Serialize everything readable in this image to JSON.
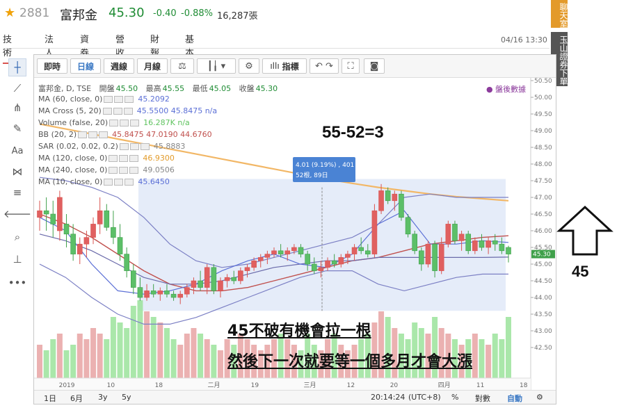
{
  "header": {
    "code": "2881",
    "name": "富邦金",
    "price": "45.30",
    "change": "-0.40",
    "change_pct": "-0.88%",
    "volume": "16,287張",
    "datetime": "04/16 13:30"
  },
  "tabs": [
    "技術",
    "法人",
    "資券",
    "營收",
    "財報",
    "基本"
  ],
  "toolbar": {
    "intraday": "即時",
    "daily": "日線",
    "weekly": "週線",
    "monthly": "月線",
    "indicators": "指標"
  },
  "side_tabs": {
    "chat": "聊天室",
    "download": "玉山證券下單"
  },
  "legend": {
    "title": "富邦金, D, TSE",
    "open_label": "開盤",
    "open": "45.50",
    "high_label": "最高",
    "high": "45.55",
    "low_label": "最低",
    "low": "45.05",
    "close_label": "收盤",
    "close": "45.30",
    "after_hours": "● 盤後數據",
    "rows": [
      {
        "name": "MA (60, close, 0)",
        "values": "45.2092",
        "color": "#5b6fd6"
      },
      {
        "name": "MA Cross (5, 20)",
        "values": "45.5500  45.8475  n/a",
        "color": "#5b6fd6"
      },
      {
        "name": "Volume (false, 20)",
        "values": "16.287K  n/a",
        "color": "#5fc35f"
      },
      {
        "name": "BB (20, 2)",
        "values": "45.8475  47.0190  44.6760",
        "color": "#c0504d"
      },
      {
        "name": "SAR (0.02, 0.02, 0.2)",
        "values": "45.8883",
        "color": "#888888"
      },
      {
        "name": "MA (120, close, 0)",
        "values": "46.9300",
        "color": "#e29b2b"
      },
      {
        "name": "MA (240, close, 0)",
        "values": "49.0506",
        "color": "#888888"
      },
      {
        "name": "MA (10, close, 0)",
        "values": "45.6450",
        "color": "#5b6fd6"
      }
    ]
  },
  "tooltip": {
    "line1": "4.01 (9.19%) , 401",
    "line2": "52根, 89日"
  },
  "bottom_bar": {
    "ranges": [
      "1日",
      "6月",
      "3y",
      "5y"
    ],
    "clock": "20:14:24",
    "tz": "(UTC+8)",
    "pct": "%",
    "log": "對數",
    "auto": "自動"
  },
  "annotations": {
    "equation": "55-52=3",
    "support": "45",
    "line1": "45不破有機會拉一根",
    "line2": "然後下一次就要等一個多月才會大漲"
  },
  "chart_data": {
    "type": "candlestick",
    "price_ylim": [
      42.0,
      50.5
    ],
    "price_ticks": [
      "50.50",
      "50.00",
      "49.50",
      "49.00",
      "48.50",
      "48.00",
      "47.50",
      "47.00",
      "46.50",
      "46.00",
      "45.50",
      "45.00",
      "44.50",
      "44.00",
      "43.50",
      "43.00",
      "42.50"
    ],
    "current_price_label": "45.30",
    "x_ticks": [
      "2019",
      "10",
      "18",
      "二月",
      "19",
      "三月",
      "12",
      "20",
      "四月",
      "11",
      "18"
    ],
    "candles": [
      {
        "o": 46.4,
        "h": 46.9,
        "l": 46.0,
        "c": 46.6
      },
      {
        "o": 46.6,
        "h": 47.0,
        "l": 46.0,
        "c": 46.5
      },
      {
        "o": 46.5,
        "h": 46.9,
        "l": 45.8,
        "c": 46.2
      },
      {
        "o": 46.0,
        "h": 47.2,
        "l": 45.7,
        "c": 47.0
      },
      {
        "o": 46.2,
        "h": 46.5,
        "l": 45.5,
        "c": 45.9
      },
      {
        "o": 45.9,
        "h": 46.2,
        "l": 45.1,
        "c": 45.3
      },
      {
        "o": 45.3,
        "h": 45.8,
        "l": 45.0,
        "c": 45.6
      },
      {
        "o": 45.6,
        "h": 46.0,
        "l": 45.2,
        "c": 45.8
      },
      {
        "o": 45.8,
        "h": 46.4,
        "l": 45.6,
        "c": 46.2
      },
      {
        "o": 46.2,
        "h": 47.0,
        "l": 45.9,
        "c": 46.6
      },
      {
        "o": 46.6,
        "h": 46.8,
        "l": 46.0,
        "c": 46.1
      },
      {
        "o": 46.1,
        "h": 46.6,
        "l": 45.6,
        "c": 45.8
      },
      {
        "o": 45.8,
        "h": 46.2,
        "l": 45.1,
        "c": 45.3
      },
      {
        "o": 45.3,
        "h": 45.5,
        "l": 44.6,
        "c": 44.8
      },
      {
        "o": 44.8,
        "h": 45.0,
        "l": 44.1,
        "c": 44.3
      },
      {
        "o": 44.3,
        "h": 44.6,
        "l": 43.9,
        "c": 44.0
      },
      {
        "o": 44.0,
        "h": 44.4,
        "l": 43.9,
        "c": 44.2
      },
      {
        "o": 44.2,
        "h": 44.4,
        "l": 44.0,
        "c": 44.1
      },
      {
        "o": 44.1,
        "h": 44.3,
        "l": 43.9,
        "c": 44.2
      },
      {
        "o": 44.2,
        "h": 44.4,
        "l": 44.0,
        "c": 44.1
      },
      {
        "o": 44.1,
        "h": 44.2,
        "l": 43.9,
        "c": 44.0
      },
      {
        "o": 44.0,
        "h": 44.2,
        "l": 43.8,
        "c": 44.1
      },
      {
        "o": 44.1,
        "h": 44.4,
        "l": 44.0,
        "c": 44.3
      },
      {
        "o": 44.3,
        "h": 44.6,
        "l": 44.1,
        "c": 44.5
      },
      {
        "o": 44.5,
        "h": 44.8,
        "l": 44.2,
        "c": 44.3
      },
      {
        "o": 44.3,
        "h": 45.0,
        "l": 44.1,
        "c": 44.9
      },
      {
        "o": 44.9,
        "h": 45.0,
        "l": 44.1,
        "c": 44.2
      },
      {
        "o": 44.2,
        "h": 44.6,
        "l": 44.0,
        "c": 44.5
      },
      {
        "o": 44.5,
        "h": 44.7,
        "l": 44.3,
        "c": 44.6
      },
      {
        "o": 44.6,
        "h": 44.8,
        "l": 44.4,
        "c": 44.5
      },
      {
        "o": 44.5,
        "h": 44.9,
        "l": 44.4,
        "c": 44.8
      },
      {
        "o": 44.8,
        "h": 45.0,
        "l": 44.6,
        "c": 44.9
      },
      {
        "o": 44.9,
        "h": 45.2,
        "l": 44.8,
        "c": 45.1
      },
      {
        "o": 45.1,
        "h": 45.3,
        "l": 44.9,
        "c": 45.2
      },
      {
        "o": 45.2,
        "h": 45.4,
        "l": 45.0,
        "c": 45.3
      },
      {
        "o": 45.3,
        "h": 45.5,
        "l": 45.2,
        "c": 45.4
      },
      {
        "o": 45.4,
        "h": 45.6,
        "l": 45.2,
        "c": 45.3
      },
      {
        "o": 45.3,
        "h": 45.5,
        "l": 45.1,
        "c": 45.4
      },
      {
        "o": 45.4,
        "h": 45.6,
        "l": 45.3,
        "c": 45.5
      },
      {
        "o": 45.5,
        "h": 45.6,
        "l": 45.2,
        "c": 45.3
      },
      {
        "o": 45.3,
        "h": 45.4,
        "l": 44.8,
        "c": 45.0
      },
      {
        "o": 45.0,
        "h": 45.2,
        "l": 44.7,
        "c": 44.8
      },
      {
        "o": 44.8,
        "h": 45.1,
        "l": 44.6,
        "c": 44.9
      },
      {
        "o": 44.9,
        "h": 45.2,
        "l": 44.8,
        "c": 45.1
      },
      {
        "o": 45.1,
        "h": 45.3,
        "l": 44.9,
        "c": 45.0
      },
      {
        "o": 45.0,
        "h": 45.3,
        "l": 44.9,
        "c": 45.2
      },
      {
        "o": 45.2,
        "h": 45.4,
        "l": 45.0,
        "c": 45.3
      },
      {
        "o": 45.3,
        "h": 45.6,
        "l": 45.1,
        "c": 45.5
      },
      {
        "o": 45.5,
        "h": 45.8,
        "l": 45.3,
        "c": 45.4
      },
      {
        "o": 45.4,
        "h": 45.6,
        "l": 45.2,
        "c": 45.3
      },
      {
        "o": 45.3,
        "h": 46.8,
        "l": 45.2,
        "c": 46.6
      },
      {
        "o": 46.6,
        "h": 47.4,
        "l": 46.5,
        "c": 47.2
      },
      {
        "o": 47.2,
        "h": 47.3,
        "l": 46.8,
        "c": 46.9
      },
      {
        "o": 46.9,
        "h": 47.2,
        "l": 46.6,
        "c": 47.1
      },
      {
        "o": 47.1,
        "h": 47.2,
        "l": 46.3,
        "c": 46.4
      },
      {
        "o": 46.4,
        "h": 46.5,
        "l": 45.8,
        "c": 45.9
      },
      {
        "o": 45.9,
        "h": 46.0,
        "l": 45.3,
        "c": 45.4
      },
      {
        "o": 45.4,
        "h": 45.5,
        "l": 44.8,
        "c": 45.0
      },
      {
        "o": 45.0,
        "h": 45.7,
        "l": 44.9,
        "c": 45.6
      },
      {
        "o": 45.6,
        "h": 45.7,
        "l": 44.6,
        "c": 44.8
      },
      {
        "o": 44.8,
        "h": 45.8,
        "l": 44.7,
        "c": 45.6
      },
      {
        "o": 45.6,
        "h": 46.3,
        "l": 45.5,
        "c": 46.2
      },
      {
        "o": 46.2,
        "h": 46.3,
        "l": 45.6,
        "c": 45.7
      },
      {
        "o": 45.7,
        "h": 46.0,
        "l": 45.4,
        "c": 45.9
      },
      {
        "o": 45.9,
        "h": 46.0,
        "l": 45.3,
        "c": 45.4
      },
      {
        "o": 45.4,
        "h": 45.8,
        "l": 45.3,
        "c": 45.7
      },
      {
        "o": 45.7,
        "h": 45.9,
        "l": 45.4,
        "c": 45.5
      },
      {
        "o": 45.5,
        "h": 45.8,
        "l": 45.3,
        "c": 45.7
      },
      {
        "o": 45.7,
        "h": 45.9,
        "l": 45.4,
        "c": 45.6
      },
      {
        "o": 45.6,
        "h": 45.8,
        "l": 45.3,
        "c": 45.4
      },
      {
        "o": 45.5,
        "h": 45.55,
        "l": 45.05,
        "c": 45.3
      }
    ],
    "ma120": [
      49.2,
      49.05,
      48.9,
      48.75,
      48.6,
      48.45,
      48.3,
      48.15,
      48.0,
      47.85,
      47.7,
      47.55,
      47.42,
      47.3,
      47.2,
      47.1,
      47.02,
      46.96,
      46.9
    ],
    "bb_upper": [
      47.6,
      47.5,
      47.3,
      47.0,
      46.4,
      45.6,
      45.1,
      44.9,
      45.0,
      45.2,
      45.4,
      45.6,
      45.8,
      46.2,
      47.0,
      47.1,
      47.0,
      47.0,
      47.0
    ],
    "bb_lower": [
      45.0,
      44.6,
      44.0,
      43.5,
      43.2,
      43.2,
      43.4,
      43.7,
      44.0,
      44.3,
      44.6,
      44.8,
      44.8,
      44.4,
      44.2,
      44.4,
      44.6,
      44.7,
      44.7
    ],
    "bb_mid": [
      46.5,
      46.2,
      45.8,
      45.3,
      44.8,
      44.4,
      44.2,
      44.2,
      44.3,
      44.5,
      44.7,
      44.9,
      45.1,
      45.2,
      45.4,
      45.6,
      45.7,
      45.8,
      45.85
    ],
    "ma60": [
      45.9,
      45.7,
      45.4,
      45.0,
      44.6,
      44.4,
      44.4,
      44.5,
      44.7,
      44.9,
      45.0,
      45.1,
      45.1,
      45.2,
      45.2,
      45.2,
      45.2,
      45.2,
      45.21
    ],
    "ma10": [
      46.4,
      46.0,
      45.0,
      44.2,
      44.1,
      44.2,
      44.4,
      44.8,
      45.1,
      45.3,
      45.0,
      44.9,
      45.3,
      46.2,
      46.6,
      45.6,
      45.6,
      45.7,
      45.65
    ],
    "volumes": [
      7,
      6,
      8,
      9,
      6,
      7,
      9,
      8,
      10,
      9,
      8,
      12,
      11,
      10,
      14,
      15,
      13,
      12,
      11,
      10,
      8,
      7,
      9,
      10,
      9,
      8,
      7,
      6,
      8,
      7,
      9,
      8,
      7,
      6,
      7,
      8,
      9,
      8,
      7,
      6,
      9,
      7,
      6,
      8,
      9,
      7,
      6,
      7,
      8,
      9,
      11,
      13,
      12,
      10,
      9,
      8,
      11,
      10,
      9,
      12,
      10,
      9,
      8,
      7,
      8,
      9,
      8,
      7,
      9,
      8,
      12
    ]
  }
}
